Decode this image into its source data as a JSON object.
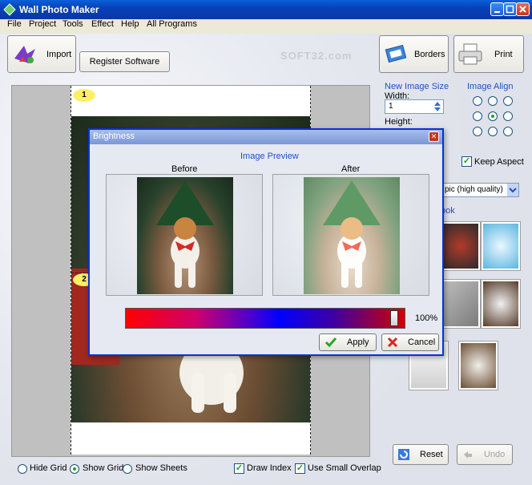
{
  "window": {
    "title": "Wall Photo Maker"
  },
  "menu": [
    "File",
    "Project",
    "Tools",
    "Effect",
    "Help",
    "All Programs"
  ],
  "toolbar": {
    "import_label": "Import",
    "register_label": "Register Software",
    "borders_label": "Borders",
    "print_label": "Print",
    "watermark": "SOFT32.com"
  },
  "sheet": {
    "badges": [
      "1",
      "2"
    ]
  },
  "right_panel": {
    "new_size_caption": "New Image Size",
    "width_label": "Width:",
    "width_value": "1",
    "height_label": "Height:",
    "align_caption": "Image Align",
    "keep_aspect_label": "Keep Aspect",
    "keep_aspect_checked": true,
    "quality_value": "pic (high quality)",
    "look_caption": "ook",
    "reset_label": "Reset",
    "undo_label": "Undo"
  },
  "statusbar": {
    "hide_grid": "Hide Grid",
    "show_grid": "Show Grid",
    "show_sheets": "Show Sheets",
    "draw_index": "Draw Index",
    "use_small_overlap": "Use Small Overlap",
    "selected": "show_grid",
    "draw_index_checked": true,
    "use_small_overlap_checked": true
  },
  "dialog": {
    "title": "Brightness",
    "preview_caption": "Image Preview",
    "before_label": "Before",
    "after_label": "After",
    "percent": "100%",
    "apply_label": "Apply",
    "cancel_label": "Cancel"
  },
  "colors": {
    "accent_blue": "#1f4fc8",
    "title_blue": "#0842b8"
  }
}
